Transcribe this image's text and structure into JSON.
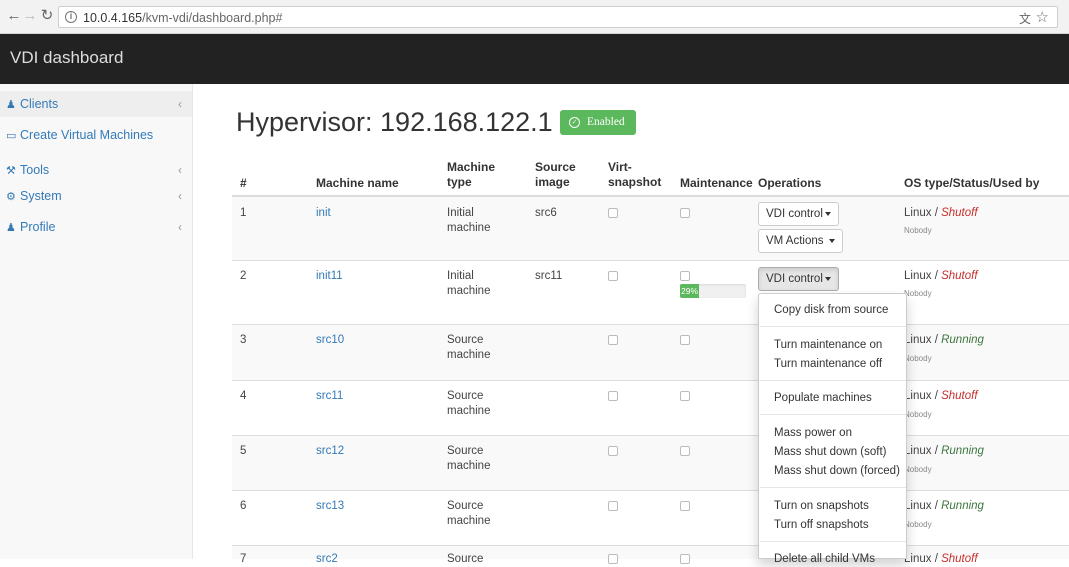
{
  "browser": {
    "url_host": "10.0.4.165",
    "url_path": "/kvm-vdi/dashboard.php#"
  },
  "navbar": {
    "brand": "VDI dashboard"
  },
  "sidebar": {
    "items": [
      {
        "label": "Clients",
        "icon": "user-icon"
      },
      {
        "label": "Create Virtual Machines",
        "icon": "laptop-icon"
      },
      {
        "label": "Tools",
        "icon": "wrench-icon"
      },
      {
        "label": "System",
        "icon": "gears-icon"
      },
      {
        "label": "Profile",
        "icon": "user-icon"
      }
    ]
  },
  "header": {
    "title": "Hypervisor: 192.168.122.1",
    "badge": "Enabled"
  },
  "table": {
    "columns": [
      "#",
      "Machine name",
      "Machine type",
      "Source image",
      "Virt-snapshot",
      "Maintenance",
      "Operations",
      "OS type/Status/Used by"
    ],
    "rows": [
      {
        "num": "1",
        "name": "init",
        "type": "Initial machine",
        "source": "src6",
        "os": "Linux",
        "status": "Shutoff",
        "used_by": "Nobody"
      },
      {
        "num": "2",
        "name": "init11",
        "type": "Initial machine",
        "source": "src11",
        "os": "Linux",
        "status": "Shutoff",
        "used_by": "Nobody",
        "progress": "29%"
      },
      {
        "num": "3",
        "name": "src10",
        "type": "Source machine",
        "source": "",
        "os": "Linux",
        "status": "Running",
        "used_by": "Nobody"
      },
      {
        "num": "4",
        "name": "src11",
        "type": "Source machine",
        "source": "",
        "os": "Linux",
        "status": "Shutoff",
        "used_by": "Nobody"
      },
      {
        "num": "5",
        "name": "src12",
        "type": "Source machine",
        "source": "",
        "os": "Linux",
        "status": "Running",
        "used_by": "Nobody"
      },
      {
        "num": "6",
        "name": "src13",
        "type": "Source machine",
        "source": "",
        "os": "Linux",
        "status": "Running",
        "used_by": "Nobody"
      },
      {
        "num": "7",
        "name": "src2",
        "type": "Source",
        "source": "",
        "os": "Linux",
        "status": "Shutoff",
        "used_by": ""
      }
    ],
    "progress_fraction": 0.29
  },
  "operations": {
    "vdi_control": "VDI control",
    "vm_actions": "VM Actions"
  },
  "dropdown_menu": {
    "items": [
      "Copy disk from source",
      "Turn maintenance on",
      "Turn maintenance off",
      "Populate machines",
      "Mass power on",
      "Mass shut down (soft)",
      "Mass shut down (forced)",
      "Turn on snapshots",
      "Turn off snapshots",
      "Delete all child VMs"
    ]
  },
  "colors": {
    "navbar": "#222222",
    "link": "#337ab7",
    "success": "#5cb85c",
    "shutoff": "#c9302c",
    "running": "#3c763d"
  }
}
